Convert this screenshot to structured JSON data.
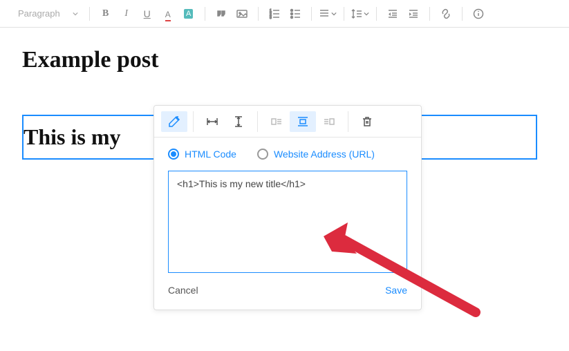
{
  "toolbar": {
    "block_type": "Paragraph"
  },
  "page": {
    "title": "Example post",
    "embed_preview": "This is my"
  },
  "popup": {
    "radio_html_label": "HTML Code",
    "radio_url_label": "Website Address (URL)",
    "code_value": "<h1>This is my new title</h1>",
    "cancel_label": "Cancel",
    "save_label": "Save"
  }
}
